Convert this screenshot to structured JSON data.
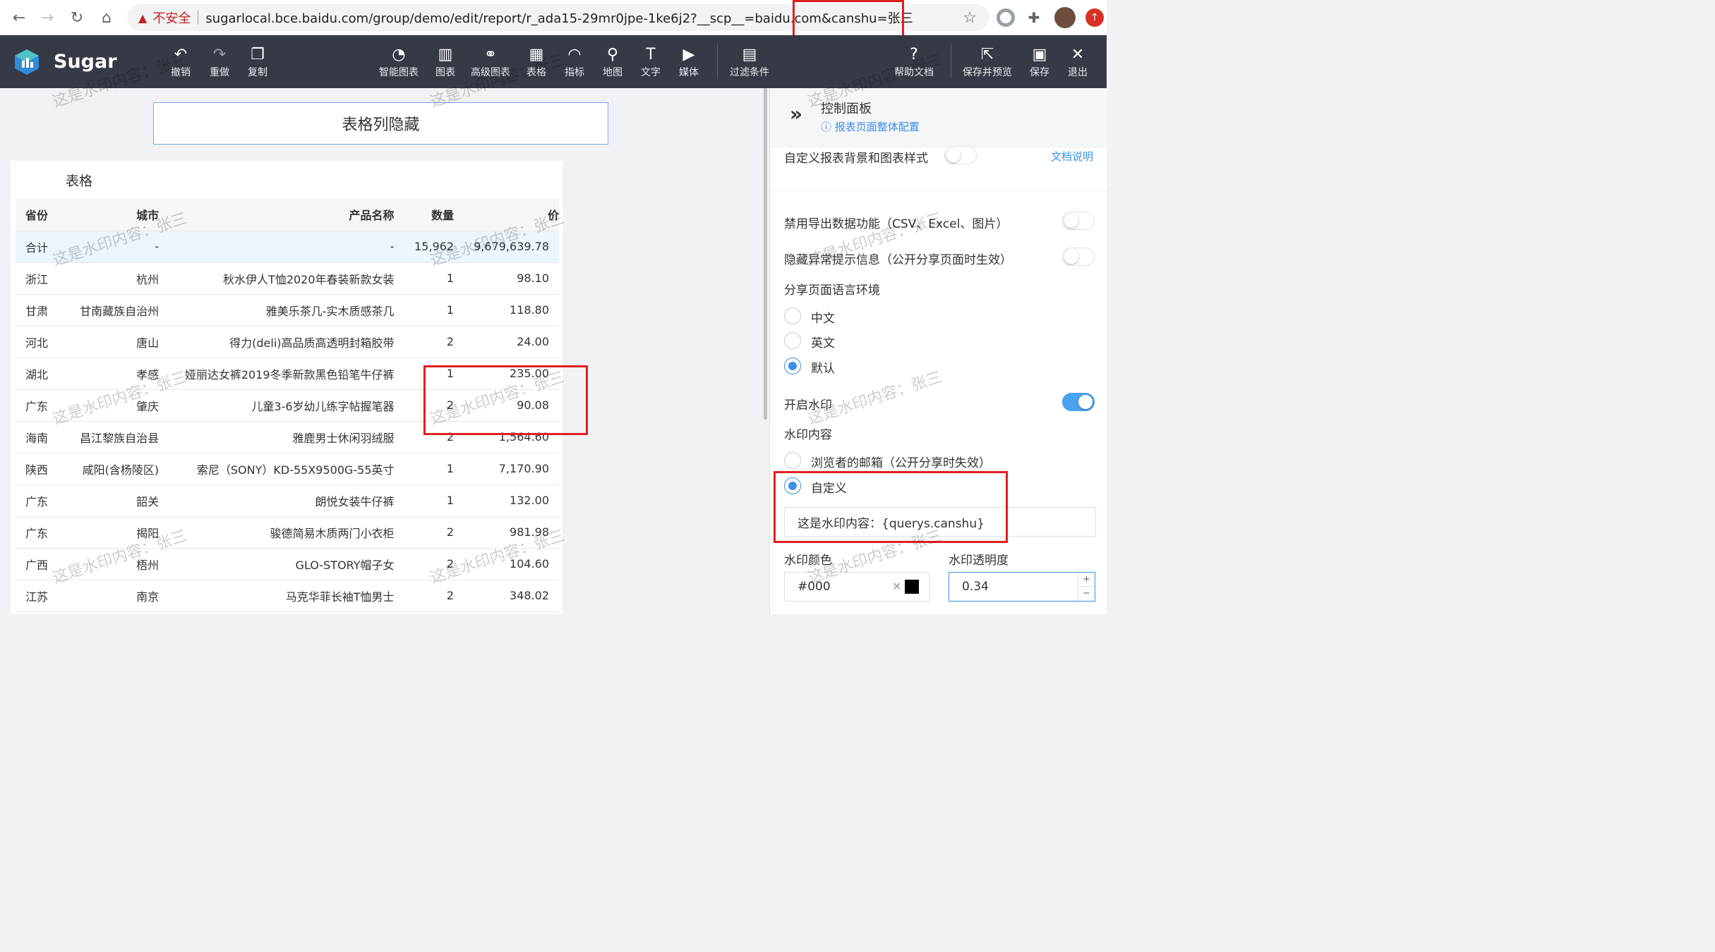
{
  "browser": {
    "insecure_label": "不安全",
    "url": "sugarlocal.bce.baidu.com/group/demo/edit/report/r_ada15-29mr0jpe-1ke6j2?__scp__=baidu.com&canshu=张三"
  },
  "toolbar": {
    "brand": "Sugar",
    "undo": "撤销",
    "redo": "重做",
    "copy": "复制",
    "smart_chart": "智能图表",
    "chart": "图表",
    "advanced_chart": "高级图表",
    "table": "表格",
    "metric": "指标",
    "map": "地图",
    "text": "文字",
    "media": "媒体",
    "filter": "过滤条件",
    "help": "帮助文档",
    "save_preview": "保存并预览",
    "save": "保存",
    "exit": "退出"
  },
  "canvas": {
    "report_title": "表格列隐藏",
    "table_title": "表格",
    "columns": [
      "省份",
      "城市",
      "产品名称",
      "数量",
      "价"
    ],
    "total": [
      "合计",
      "-",
      "-",
      "15,962",
      "9,679,639.78"
    ],
    "rows": [
      [
        "浙江",
        "杭州",
        "秋水伊人T恤2020年春装新款女装",
        "1",
        "98.10"
      ],
      [
        "甘肃",
        "甘南藏族自治州",
        "雅美乐茶几-实木质感茶几",
        "1",
        "118.80"
      ],
      [
        "河北",
        "唐山",
        "得力(deli)高品质高透明封箱胶带",
        "2",
        "24.00"
      ],
      [
        "湖北",
        "孝感",
        "娅丽达女裤2019冬季新款黑色铅笔牛仔裤",
        "1",
        "235.00"
      ],
      [
        "广东",
        "肇庆",
        "儿童3-6岁幼儿练字帖握笔器",
        "2",
        "90.08"
      ],
      [
        "海南",
        "昌江黎族自治县",
        "雅鹿男士休闲羽绒服",
        "2",
        "1,564.60"
      ],
      [
        "陕西",
        "咸阳(含杨陵区)",
        "索尼（SONY）KD-55X9500G-55英寸",
        "1",
        "7,170.90"
      ],
      [
        "广东",
        "韶关",
        "朗悦女装牛仔裤",
        "1",
        "132.00"
      ],
      [
        "广东",
        "揭阳",
        "骏德简易木质两门小衣柜",
        "2",
        "981.98"
      ],
      [
        "广西",
        "梧州",
        "GLO-STORY帽子女",
        "2",
        "104.60"
      ],
      [
        "江苏",
        "南京",
        "马克华菲长袖T恤男士",
        "2",
        "348.02"
      ]
    ]
  },
  "panel": {
    "title": "控制面板",
    "subtitle": "报表页面整体配置",
    "custom_bg": "自定义报表背景和图表样式",
    "doc_link": "文档说明",
    "disable_export": "禁用导出数据功能（CSV、Excel、图片）",
    "hide_errors": "隐藏异常提示信息（公开分享页面时生效）",
    "share_lang": "分享页面语言环境",
    "lang_zh": "中文",
    "lang_en": "英文",
    "lang_default": "默认",
    "watermark_on": "开启水印",
    "watermark_content": "水印内容",
    "wm_email": "浏览者的邮箱（公开分享时失效）",
    "wm_custom": "自定义",
    "wm_custom_value": "这是水印内容：{querys.canshu}",
    "wm_color_label": "水印颜色",
    "wm_color_value": "#000",
    "wm_opacity_label": "水印透明度",
    "wm_opacity_value": "0.34"
  },
  "watermark_text": "这是水印内容：张三",
  "colors": {
    "toolbar_bg": "#353a46",
    "accent": "#3a8ee6",
    "highlight": "#e02020"
  }
}
